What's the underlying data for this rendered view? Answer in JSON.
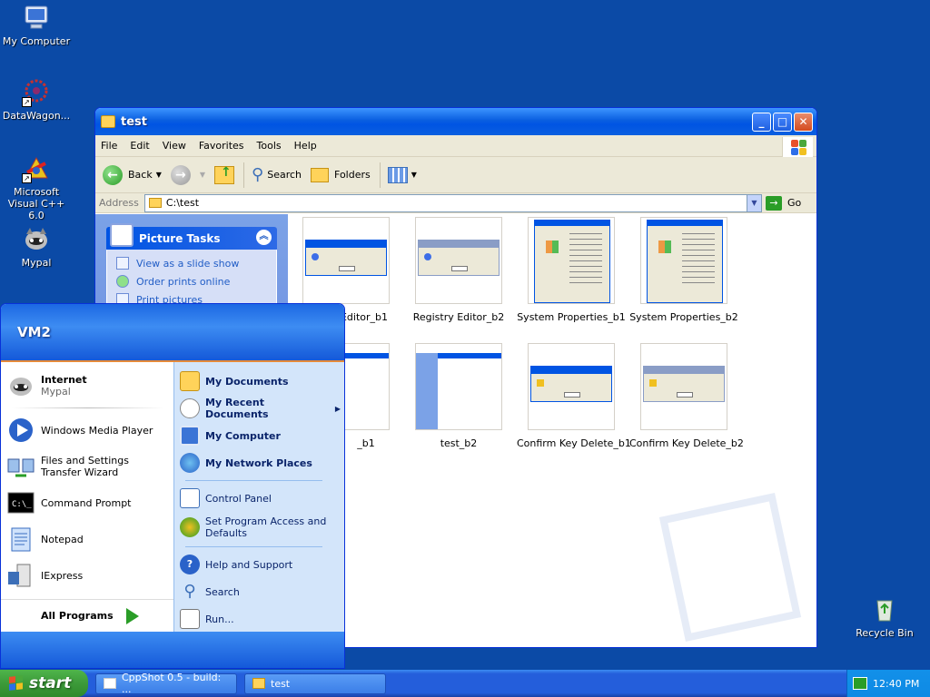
{
  "desktop": {
    "icons": [
      {
        "label": "My Computer",
        "icon": "my-computer-icon"
      },
      {
        "label": "DataWagon...",
        "icon": "datawagon-icon"
      },
      {
        "label": "Microsoft Visual C++ 6.0",
        "icon": "visual-cpp-icon"
      },
      {
        "label": "Mypal",
        "icon": "mypal-icon"
      },
      {
        "label": "Recycle Bin",
        "icon": "recycle-bin-icon"
      }
    ]
  },
  "window": {
    "title": "test",
    "menu": [
      "File",
      "Edit",
      "View",
      "Favorites",
      "Tools",
      "Help"
    ],
    "toolbar": {
      "back": "Back",
      "search": "Search",
      "folders": "Folders"
    },
    "address": {
      "label": "Address",
      "value": "C:\\test",
      "go": "Go"
    },
    "task_pane": {
      "title": "Picture Tasks",
      "links": [
        "View as a slide show",
        "Order prints online",
        "Print pictures"
      ]
    },
    "files": [
      {
        "name": "Registry Editor_b1",
        "visible_name": "Editor_b1",
        "type": "dialog"
      },
      {
        "name": "Registry Editor_b2",
        "type": "dialog-grey"
      },
      {
        "name": "System Properties_b1",
        "type": "props"
      },
      {
        "name": "System Properties_b2",
        "type": "props"
      },
      {
        "name": "test_b1",
        "visible_name": "_b1",
        "type": "explorer"
      },
      {
        "name": "test_b2",
        "type": "explorer"
      },
      {
        "name": "Confirm Key Delete_b1",
        "type": "warn"
      },
      {
        "name": "Confirm Key Delete_b2",
        "type": "warn"
      }
    ]
  },
  "start_menu": {
    "user": "VM2",
    "left": [
      {
        "title": "Internet",
        "sub": "Mypal",
        "icon": "mypal-icon"
      },
      {
        "title": "Windows Media Player",
        "icon": "media-player-icon"
      },
      {
        "title": "Files and Settings Transfer Wizard",
        "icon": "transfer-wizard-icon"
      },
      {
        "title": "Command Prompt",
        "icon": "command-prompt-icon"
      },
      {
        "title": "Notepad",
        "icon": "notepad-icon"
      },
      {
        "title": "IExpress",
        "icon": "iexpress-icon"
      }
    ],
    "all_programs": "All Programs",
    "right": [
      {
        "label": "My Documents",
        "bold": true,
        "icon": "my-documents-icon"
      },
      {
        "label": "My Recent Documents",
        "bold": true,
        "icon": "recent-documents-icon",
        "submenu": true
      },
      {
        "label": "My Computer",
        "bold": true,
        "icon": "my-computer-icon"
      },
      {
        "label": "My Network Places",
        "bold": true,
        "icon": "network-places-icon"
      },
      {
        "label": "Control Panel",
        "icon": "control-panel-icon"
      },
      {
        "label": "Set Program Access and Defaults",
        "icon": "program-access-icon"
      },
      {
        "label": "Help and Support",
        "icon": "help-icon"
      },
      {
        "label": "Search",
        "icon": "search-icon"
      },
      {
        "label": "Run...",
        "icon": "run-icon"
      }
    ]
  },
  "taskbar": {
    "start": "start",
    "buttons": [
      {
        "label": "CppShot 0.5 - build: ...",
        "icon": "cppshot-icon"
      },
      {
        "label": "test",
        "icon": "folder-icon"
      }
    ],
    "clock": "12:40 PM"
  },
  "colors": {
    "desktop_bg": "#0b4aa6",
    "title_blue": "#0054e3",
    "start_green": "#3c9a39",
    "link_blue": "#215dc6"
  }
}
